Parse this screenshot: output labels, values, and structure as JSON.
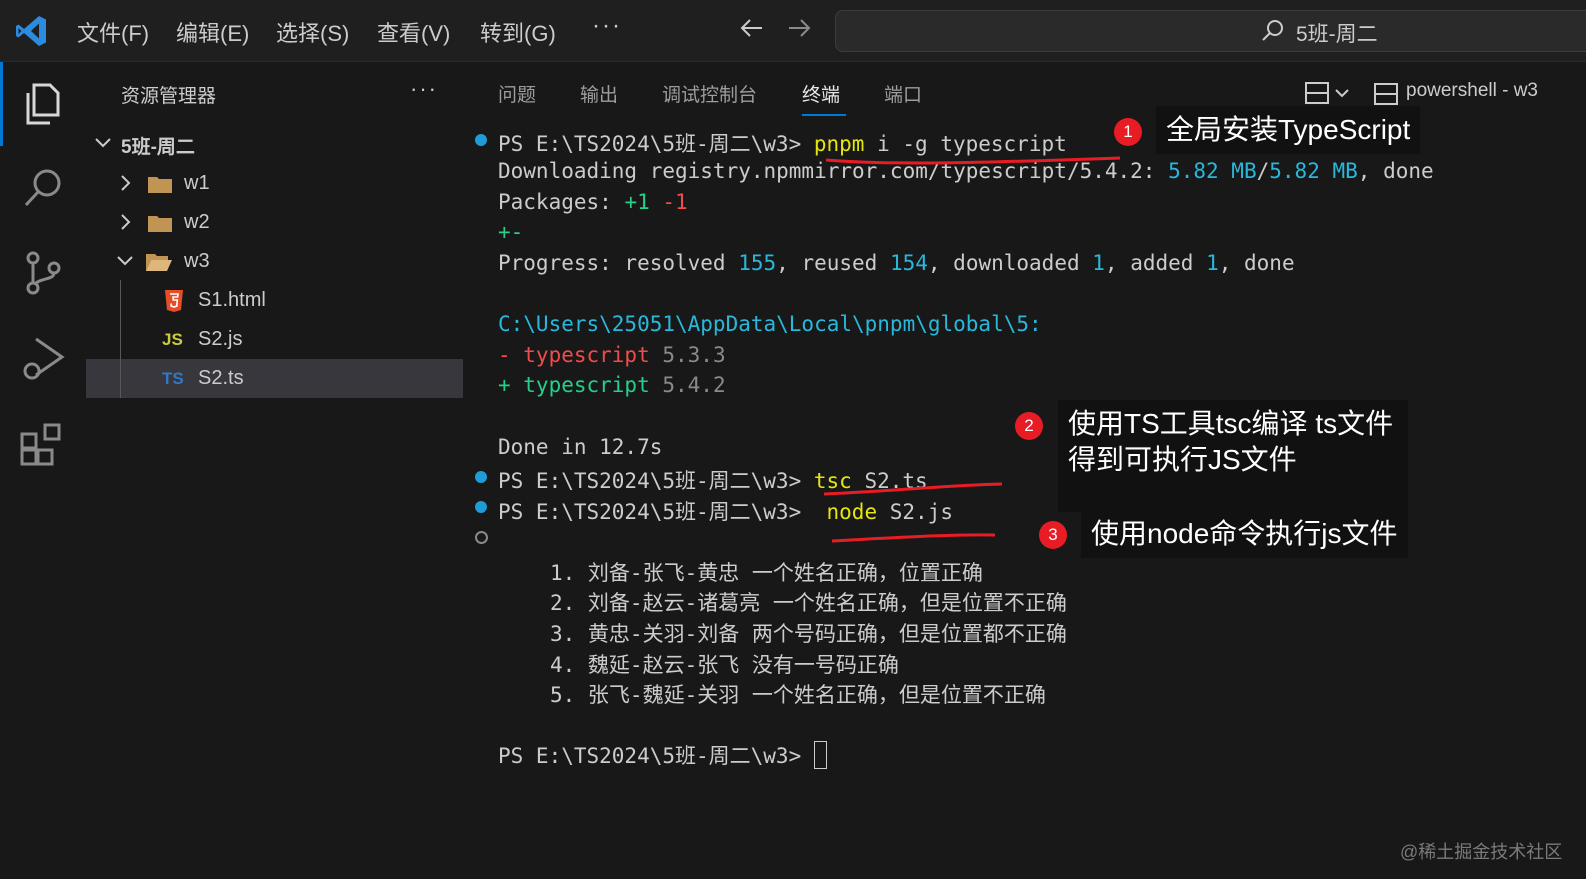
{
  "titlebar": {
    "menus": [
      "文件(F)",
      "编辑(E)",
      "选择(S)",
      "查看(V)",
      "转到(G)"
    ],
    "more": "···",
    "search_text": "5班-周二"
  },
  "explorer": {
    "title": "资源管理器",
    "more": "···",
    "root": "5班-周二",
    "items": [
      {
        "label": "w1",
        "type": "folder"
      },
      {
        "label": "w2",
        "type": "folder"
      },
      {
        "label": "w3",
        "type": "folder-open"
      },
      {
        "label": "S1.html",
        "type": "html",
        "icon": "5"
      },
      {
        "label": "S2.js",
        "type": "js",
        "icon": "JS"
      },
      {
        "label": "S2.ts",
        "type": "ts",
        "icon": "TS"
      }
    ]
  },
  "panel": {
    "tabs": [
      "问题",
      "输出",
      "调试控制台",
      "终端",
      "端口"
    ],
    "active_tab": "终端",
    "terminal_name": "powershell - w3"
  },
  "terminal": {
    "prompt": "PS E:\\TS2024\\5班-周二\\w3>",
    "cmd1": "pnpm",
    "cmd1_args": "i -g typescript",
    "download_prefix": "Downloading registry.npmmirror.com/typescript/5.4.2: ",
    "download_size": "5.82 MB",
    "download_total": "5.82 MB",
    "download_suffix": ", done",
    "packages_label": "Packages: ",
    "packages_plus": "+1",
    "packages_minus": "-1",
    "plusminus": "+-",
    "progress_label": "Progress: resolved ",
    "resolved": "155",
    "reused_label": ", reused ",
    "reused": "154",
    "downloaded_label": ", downloaded ",
    "downloaded": "1",
    "added_label": ", added ",
    "added": "1",
    "progress_done": ", done",
    "global_path": "C:\\Users\\25051\\AppData\\Local\\pnpm\\global\\5:",
    "removed_pkg": "- typescript",
    "removed_ver": "5.3.3",
    "added_pkg": "+ typescript",
    "added_ver": "5.4.2",
    "done_line": "Done in 12.7s",
    "cmd2": "tsc",
    "cmd2_args": "S2.ts",
    "cmd3": "node",
    "cmd3_args": "S2.js",
    "output": [
      "1. 刘备-张飞-黄忠 一个姓名正确，位置正确",
      "2. 刘备-赵云-诸葛亮 一个姓名正确，但是位置不正确",
      "3. 黄忠-关羽-刘备 两个号码正确，但是位置都不正确",
      "4. 魏延-赵云-张飞 没有一号码正确",
      "5. 张飞-魏延-关羽 一个姓名正确，但是位置不正确"
    ]
  },
  "callouts": {
    "badge1": "1",
    "text1": "全局安装TypeScript",
    "badge2": "2",
    "text2_line1": "使用TS工具tsc编译 ts文件",
    "text2_line2": "得到可执行JS文件",
    "badge3": "3",
    "text3": "使用node命令执行js文件"
  },
  "watermark": "@稀土掘金技术社区",
  "colors": {
    "accent": "#0078d4",
    "annotation_red": "#e81c24",
    "terminal_yellow": "#e5e510",
    "terminal_cyan": "#29b8db",
    "terminal_green": "#23d18b",
    "terminal_red": "#f14c4c"
  }
}
